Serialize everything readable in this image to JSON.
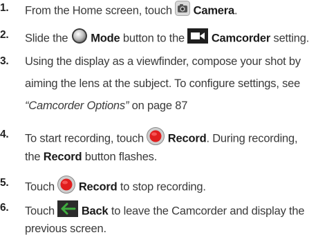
{
  "steps": [
    {
      "number": "1.",
      "line1": {
        "pre": "From the Home screen, touch",
        "icon": "camera-app-icon",
        "bold": "Camera",
        "post": "."
      }
    },
    {
      "number": "2.",
      "line1": {
        "pre": "Slide the",
        "icon": "mode-button-icon",
        "bold": "Mode",
        "mid": "button to the",
        "icon2": "camcorder-icon",
        "bold2": "Camcorder",
        "post": "setting."
      }
    },
    {
      "number": "3.",
      "line1": "Using the display as a viewfinder, compose your shot by",
      "line2": "aiming the lens at the subject. To configure settings, see",
      "line3": {
        "italic": "“Camcorder Options”",
        "post": "on page 87"
      }
    },
    {
      "number": "4.",
      "line1": {
        "pre": "To start recording, touch",
        "icon": "record-button-icon",
        "bold": "Record",
        "post": ". During recording,"
      },
      "line2": {
        "pre": "the",
        "bold": "Record",
        "post": "button flashes."
      }
    },
    {
      "number": "5.",
      "line1": {
        "pre": "Touch",
        "icon": "record-button-icon",
        "bold": "Record",
        "post": "to stop recording."
      }
    },
    {
      "number": "6.",
      "line1": {
        "pre": "Touch",
        "icon": "back-arrow-icon",
        "bold": "Back",
        "post": "to leave the Camcorder and display the"
      },
      "line2": "previous screen."
    }
  ],
  "colors": {
    "text": "#3a3a3a",
    "record_red": "#e01e1e",
    "back_green": "#3fae3f",
    "icon_dark": "#1f1f1f"
  }
}
